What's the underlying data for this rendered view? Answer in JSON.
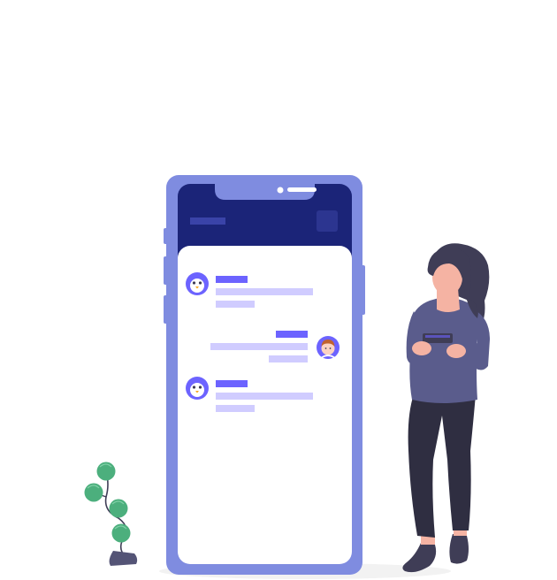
{
  "illustration": {
    "kind": "mobile-chat-illustration",
    "colors": {
      "phone_body": "#7f8ce0",
      "phone_side_buttons": "#7f8ce0",
      "screen_header": "#1b2478",
      "screen_bg": "#ffffff",
      "accent": "#6c63ff",
      "bubble_light": "#d0ccff",
      "plant_leaf": "#4caf7d",
      "pot": "#545476",
      "person_top": "#5a5c8c",
      "person_pants": "#3f3d56",
      "hair": "#3f3d56",
      "skin": "#f5b3a3"
    },
    "chat": {
      "messages": [
        {
          "sender": "bot",
          "avatar_icon": "penguin-icon",
          "side": "left"
        },
        {
          "sender": "user",
          "avatar_icon": "user-face-icon",
          "side": "right"
        },
        {
          "sender": "bot",
          "avatar_icon": "penguin-icon",
          "side": "left"
        }
      ]
    }
  }
}
